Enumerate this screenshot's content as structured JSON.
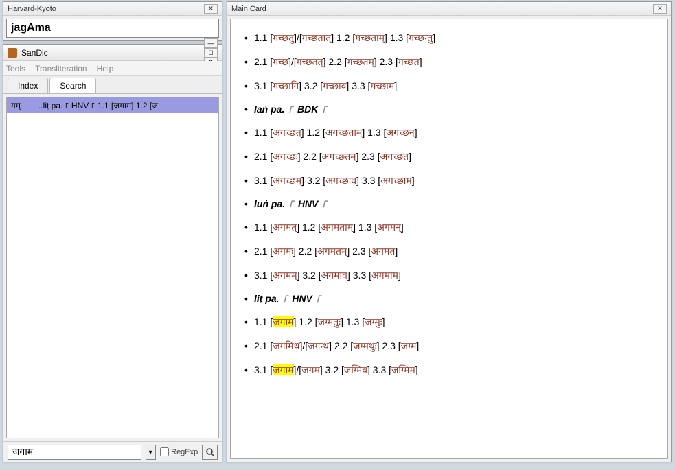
{
  "hk": {
    "title": "Harvard-Kyoto",
    "value": "jagAma"
  },
  "sandic": {
    "title": "SanDic",
    "menus": [
      "Tools",
      "Transliteration",
      "Help"
    ],
    "tabs": {
      "index": "Index",
      "search": "Search"
    },
    "result": {
      "col1": "गम्",
      "col2": "..liṭ pa. ꜒ HNV ꜒ 1.1 [जगाम] 1.2 [ज"
    },
    "bottom_value": "जगाम",
    "regexp_label": "RegExp"
  },
  "maincard": {
    "title": "Main Card",
    "lines": [
      {
        "type": "forms",
        "parts": [
          {
            "t": "plain",
            "v": "1.1 ["
          },
          {
            "t": "s",
            "v": "गच्छतु"
          },
          {
            "t": "plain",
            "v": "]/["
          },
          {
            "t": "s",
            "v": "गच्छतात्"
          },
          {
            "t": "plain",
            "v": "] 1.2 ["
          },
          {
            "t": "s",
            "v": "गच्छताम्"
          },
          {
            "t": "plain",
            "v": "] 1.3 ["
          },
          {
            "t": "s",
            "v": "गच्छन्तु"
          },
          {
            "t": "plain",
            "v": "]"
          }
        ]
      },
      {
        "type": "forms",
        "parts": [
          {
            "t": "plain",
            "v": "2.1 ["
          },
          {
            "t": "s",
            "v": "गच्छ"
          },
          {
            "t": "plain",
            "v": "]/["
          },
          {
            "t": "s",
            "v": "गच्छतत्"
          },
          {
            "t": "plain",
            "v": "] 2.2 ["
          },
          {
            "t": "s",
            "v": "गच्छतम्"
          },
          {
            "t": "plain",
            "v": "] 2.3 ["
          },
          {
            "t": "s",
            "v": "गच्छत"
          },
          {
            "t": "plain",
            "v": "]"
          }
        ]
      },
      {
        "type": "forms",
        "parts": [
          {
            "t": "plain",
            "v": "3.1 ["
          },
          {
            "t": "s",
            "v": "गच्छानि"
          },
          {
            "t": "plain",
            "v": "] 3.2 ["
          },
          {
            "t": "s",
            "v": "गच्छाव"
          },
          {
            "t": "plain",
            "v": "] 3.3 ["
          },
          {
            "t": "s",
            "v": "गच्छाम"
          },
          {
            "t": "plain",
            "v": "]"
          }
        ]
      },
      {
        "type": "header",
        "tense": "laṅ pa.",
        "code": "BDK"
      },
      {
        "type": "forms",
        "parts": [
          {
            "t": "plain",
            "v": "1.1 ["
          },
          {
            "t": "s",
            "v": "अगच्छत्"
          },
          {
            "t": "plain",
            "v": "] 1.2 ["
          },
          {
            "t": "s",
            "v": "अगच्छताम्"
          },
          {
            "t": "plain",
            "v": "] 1.3 ["
          },
          {
            "t": "s",
            "v": "अगच्छन्"
          },
          {
            "t": "plain",
            "v": "]"
          }
        ]
      },
      {
        "type": "forms",
        "parts": [
          {
            "t": "plain",
            "v": "2.1 ["
          },
          {
            "t": "s",
            "v": "अगच्छः"
          },
          {
            "t": "plain",
            "v": "] 2.2 ["
          },
          {
            "t": "s",
            "v": "अगच्छतम्"
          },
          {
            "t": "plain",
            "v": "] 2.3 ["
          },
          {
            "t": "s",
            "v": "अगच्छत"
          },
          {
            "t": "plain",
            "v": "]"
          }
        ]
      },
      {
        "type": "forms",
        "parts": [
          {
            "t": "plain",
            "v": "3.1 ["
          },
          {
            "t": "s",
            "v": "अगच्छम्"
          },
          {
            "t": "plain",
            "v": "] 3.2 ["
          },
          {
            "t": "s",
            "v": "अगच्छाव"
          },
          {
            "t": "plain",
            "v": "] 3.3 ["
          },
          {
            "t": "s",
            "v": "अगच्छाम"
          },
          {
            "t": "plain",
            "v": "]"
          }
        ]
      },
      {
        "type": "header",
        "tense": "luṅ pa.",
        "code": "HNV"
      },
      {
        "type": "forms",
        "parts": [
          {
            "t": "plain",
            "v": "1.1 ["
          },
          {
            "t": "s",
            "v": "अगमत्"
          },
          {
            "t": "plain",
            "v": "] 1.2 ["
          },
          {
            "t": "s",
            "v": "अगमताम्"
          },
          {
            "t": "plain",
            "v": "] 1.3 ["
          },
          {
            "t": "s",
            "v": "अगमन्"
          },
          {
            "t": "plain",
            "v": "]"
          }
        ]
      },
      {
        "type": "forms",
        "parts": [
          {
            "t": "plain",
            "v": "2.1 ["
          },
          {
            "t": "s",
            "v": "अगमः"
          },
          {
            "t": "plain",
            "v": "] 2.2 ["
          },
          {
            "t": "s",
            "v": "अगमतम्"
          },
          {
            "t": "plain",
            "v": "] 2.3 ["
          },
          {
            "t": "s",
            "v": "अगमत"
          },
          {
            "t": "plain",
            "v": "]"
          }
        ]
      },
      {
        "type": "forms",
        "parts": [
          {
            "t": "plain",
            "v": "3.1 ["
          },
          {
            "t": "s",
            "v": "अगमम्"
          },
          {
            "t": "plain",
            "v": "] 3.2 ["
          },
          {
            "t": "s",
            "v": "अगमाव"
          },
          {
            "t": "plain",
            "v": "] 3.3 ["
          },
          {
            "t": "s",
            "v": "अगमाम"
          },
          {
            "t": "plain",
            "v": "]"
          }
        ]
      },
      {
        "type": "header",
        "tense": "liṭ pa.",
        "code": "HNV"
      },
      {
        "type": "forms",
        "parts": [
          {
            "t": "plain",
            "v": "1.1 ["
          },
          {
            "t": "hl",
            "v": "जगाम"
          },
          {
            "t": "plain",
            "v": "] 1.2 ["
          },
          {
            "t": "s",
            "v": "जग्मतुः"
          },
          {
            "t": "plain",
            "v": "] 1.3 ["
          },
          {
            "t": "s",
            "v": "जग्मुः"
          },
          {
            "t": "plain",
            "v": "]"
          }
        ]
      },
      {
        "type": "forms",
        "parts": [
          {
            "t": "plain",
            "v": "2.1 ["
          },
          {
            "t": "s",
            "v": "जगमिथ"
          },
          {
            "t": "plain",
            "v": "]/["
          },
          {
            "t": "s",
            "v": "जगन्थ"
          },
          {
            "t": "plain",
            "v": "] 2.2 ["
          },
          {
            "t": "s",
            "v": "जग्मथुः"
          },
          {
            "t": "plain",
            "v": "] 2.3 ["
          },
          {
            "t": "s",
            "v": "जग्म"
          },
          {
            "t": "plain",
            "v": "]"
          }
        ]
      },
      {
        "type": "forms",
        "parts": [
          {
            "t": "plain",
            "v": "3.1 ["
          },
          {
            "t": "hl",
            "v": "जगाम"
          },
          {
            "t": "plain",
            "v": "]/["
          },
          {
            "t": "s",
            "v": "जगम"
          },
          {
            "t": "plain",
            "v": "] 3.2 ["
          },
          {
            "t": "s",
            "v": "जग्मिव"
          },
          {
            "t": "plain",
            "v": "] 3.3 ["
          },
          {
            "t": "s",
            "v": "जग्मिम"
          },
          {
            "t": "plain",
            "v": "]"
          }
        ]
      }
    ]
  }
}
